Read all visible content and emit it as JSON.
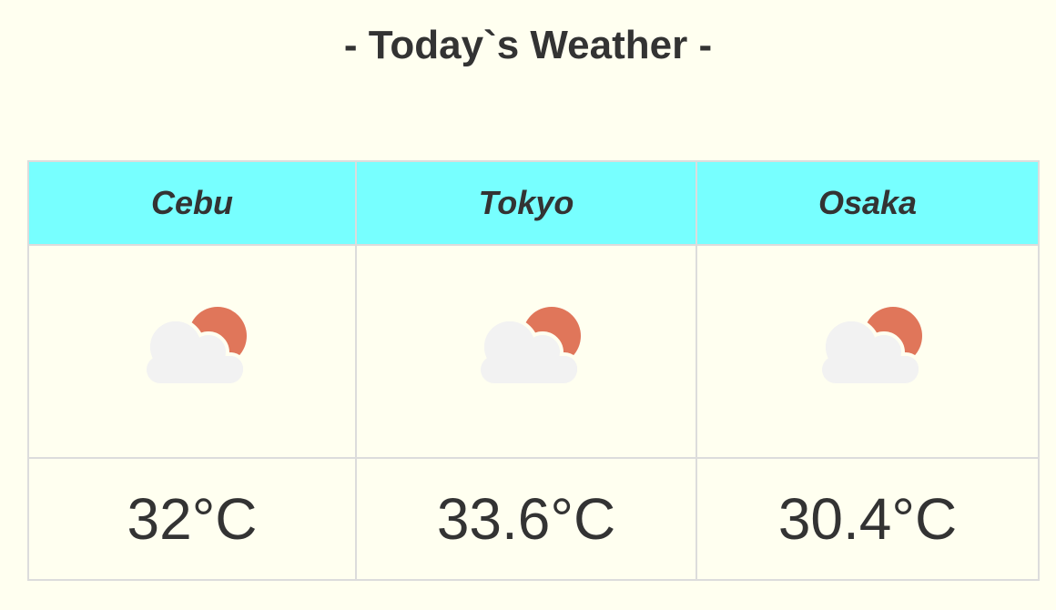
{
  "page": {
    "title": "- Today`s Weather -"
  },
  "colors": {
    "background": "#fffff0",
    "header_bg": "#77ffff",
    "border": "#dcdcdc",
    "text": "#333333",
    "sun": "#e0765a",
    "cloud": "#f2f2f2"
  },
  "cities": [
    {
      "name": "Cebu",
      "icon": "partly-cloudy-icon",
      "temp": "32°C"
    },
    {
      "name": "Tokyo",
      "icon": "partly-cloudy-icon",
      "temp": "33.6°C"
    },
    {
      "name": "Osaka",
      "icon": "partly-cloudy-icon",
      "temp": "30.4°C"
    }
  ]
}
